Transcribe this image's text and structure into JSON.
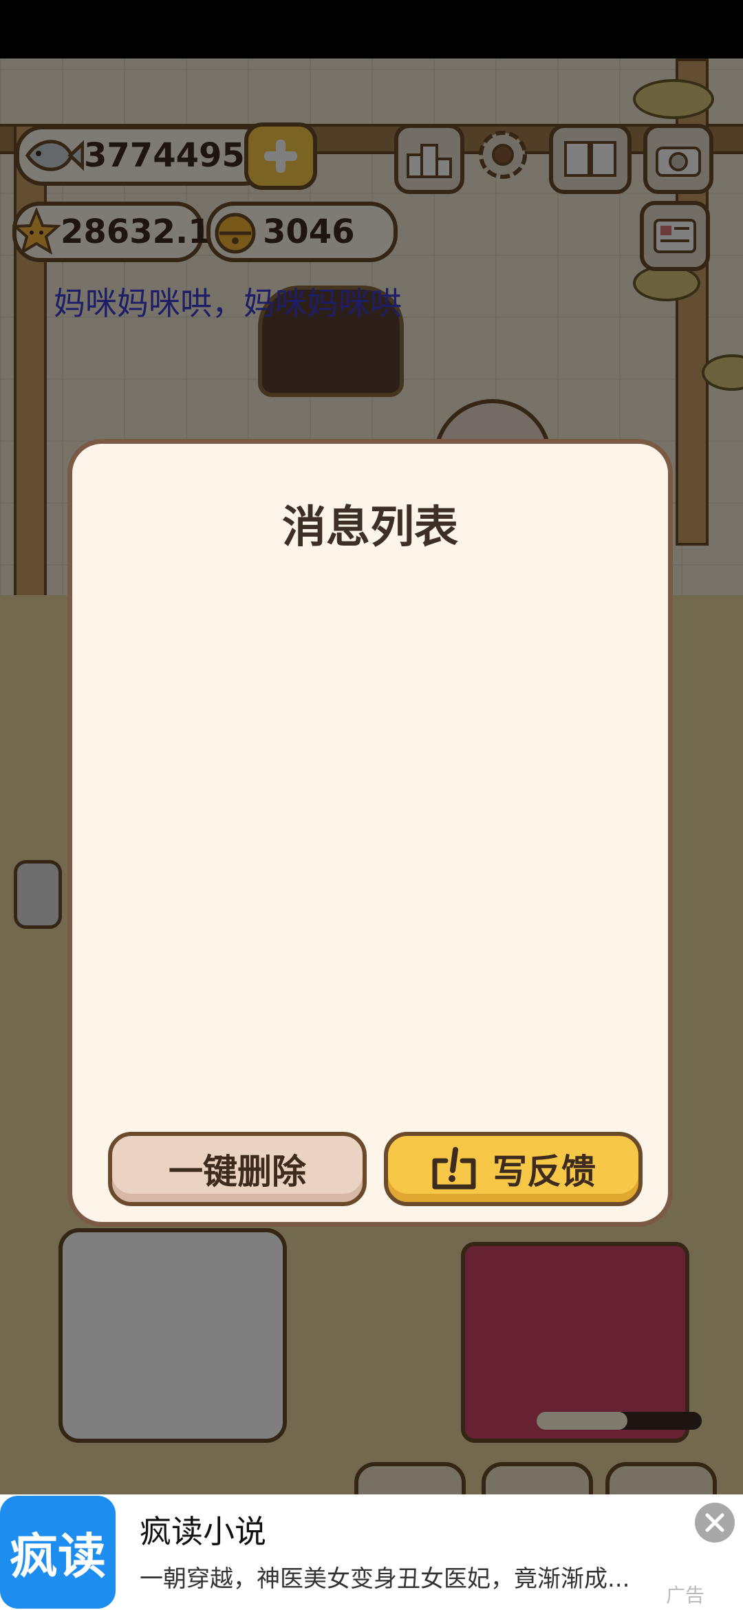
{
  "hud": {
    "fish": "3774495",
    "stars": "28632.1",
    "bells": "3046"
  },
  "marquee": "妈咪妈咪哄，妈咪妈咪哄",
  "dialog": {
    "title": "消息列表",
    "delete_all": "一键删除",
    "write_feedback": "写反馈"
  },
  "progress": {
    "value": 0.55
  },
  "ad": {
    "logo_text": "疯读",
    "title": "疯读小说",
    "description": "一朝穿越，神医美女变身丑女医妃，竟渐渐成...",
    "tag": "广告"
  }
}
